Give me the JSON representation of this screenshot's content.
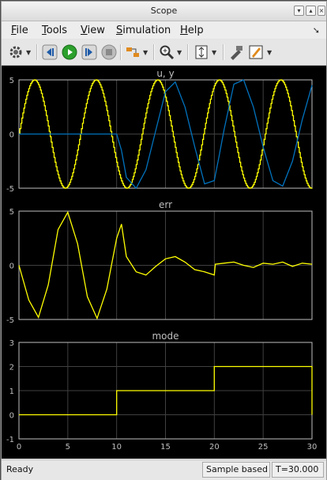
{
  "window": {
    "title": "Scope"
  },
  "menu": {
    "items": [
      "File",
      "Tools",
      "View",
      "Simulation",
      "Help"
    ],
    "mnemonics": [
      "F",
      "T",
      "V",
      "S",
      "H"
    ]
  },
  "toolbar": {
    "icons": [
      "settings-gear",
      "step-back",
      "run",
      "step-forward",
      "stop",
      "signal-selector",
      "zoom",
      "autoscale",
      "highlight-block",
      "edit-style"
    ]
  },
  "status": {
    "ready": "Ready",
    "mode": "Sample based",
    "time": "T=30.000"
  },
  "colors": {
    "signal_u": "#ffff00",
    "signal_y": "#0072bd",
    "axes": "#bfbfbf",
    "grid": "#404040",
    "background": "#000000"
  },
  "chart_data": [
    {
      "type": "line",
      "title": "u, y",
      "xlim": [
        0,
        30
      ],
      "ylim": [
        -5,
        5
      ],
      "yticks": [
        -5,
        0,
        5
      ],
      "grid": true,
      "series": [
        {
          "color": "#ffff00",
          "shape": "sine",
          "amplitude": 5,
          "period": 6.3,
          "x": [
            0,
            30
          ]
        },
        {
          "color": "#0072bd",
          "x": [
            0,
            10,
            10.5,
            11,
            12,
            13,
            14,
            15,
            16,
            17,
            18,
            19,
            20,
            20.5,
            21,
            22,
            23,
            24,
            25,
            26,
            27,
            28,
            29,
            30
          ],
          "y": [
            0,
            0,
            -1.5,
            -4.0,
            -5.0,
            -3.3,
            0.3,
            3.9,
            4.8,
            2.5,
            -1.2,
            -4.6,
            -4.3,
            -2.0,
            0.4,
            4.6,
            5.0,
            2.5,
            -1.2,
            -4.3,
            -4.8,
            -2.5,
            1.3,
            4.5
          ]
        }
      ]
    },
    {
      "type": "line",
      "title": "err",
      "xlim": [
        0,
        30
      ],
      "ylim": [
        -5,
        5
      ],
      "yticks": [
        -5,
        0,
        5
      ],
      "grid": true,
      "series": [
        {
          "color": "#ffff00",
          "x": [
            0,
            1,
            2,
            3,
            4,
            5,
            6,
            7,
            8,
            9,
            10,
            10.5,
            11,
            12,
            13,
            14,
            15,
            16,
            17,
            18,
            19,
            20,
            20.1,
            21,
            22,
            23,
            24,
            25,
            26,
            27,
            28,
            29,
            30
          ],
          "y": [
            0,
            -3.2,
            -4.8,
            -1.8,
            3.3,
            4.9,
            2.0,
            -2.9,
            -4.9,
            -2.2,
            2.5,
            3.8,
            0.8,
            -0.6,
            -0.9,
            -0.1,
            0.6,
            0.8,
            0.3,
            -0.4,
            -0.6,
            -0.9,
            0.1,
            0.2,
            0.3,
            0.0,
            -0.2,
            0.2,
            0.1,
            0.3,
            -0.1,
            0.2,
            0.1
          ]
        }
      ]
    },
    {
      "type": "line",
      "title": "mode",
      "xlim": [
        0,
        30
      ],
      "ylim": [
        -1,
        3
      ],
      "yticks": [
        -1,
        0,
        1,
        2,
        3
      ],
      "xticks": [
        0,
        5,
        10,
        15,
        20,
        25,
        30
      ],
      "grid": true,
      "series": [
        {
          "color": "#ffff00",
          "step": true,
          "x": [
            0,
            10,
            10,
            20,
            20,
            30,
            30
          ],
          "y": [
            0,
            0,
            1,
            1,
            2,
            2,
            0
          ]
        }
      ]
    }
  ]
}
